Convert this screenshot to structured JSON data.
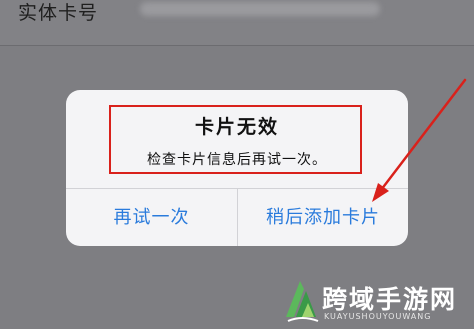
{
  "background": {
    "row_label": "实体卡号"
  },
  "alert": {
    "title": "卡片无效",
    "message": "检查卡片信息后再试一次。",
    "buttons": {
      "retry": "再试一次",
      "add_later": "稍后添加卡片"
    }
  },
  "annotation": {
    "color": "#d9211b"
  },
  "watermark": {
    "name": "跨域手游网",
    "url": "KUAYUSHOUYOUWANG"
  },
  "colors": {
    "button_text": "#2a7bdc",
    "dim_overlay": "#7e7e82"
  }
}
